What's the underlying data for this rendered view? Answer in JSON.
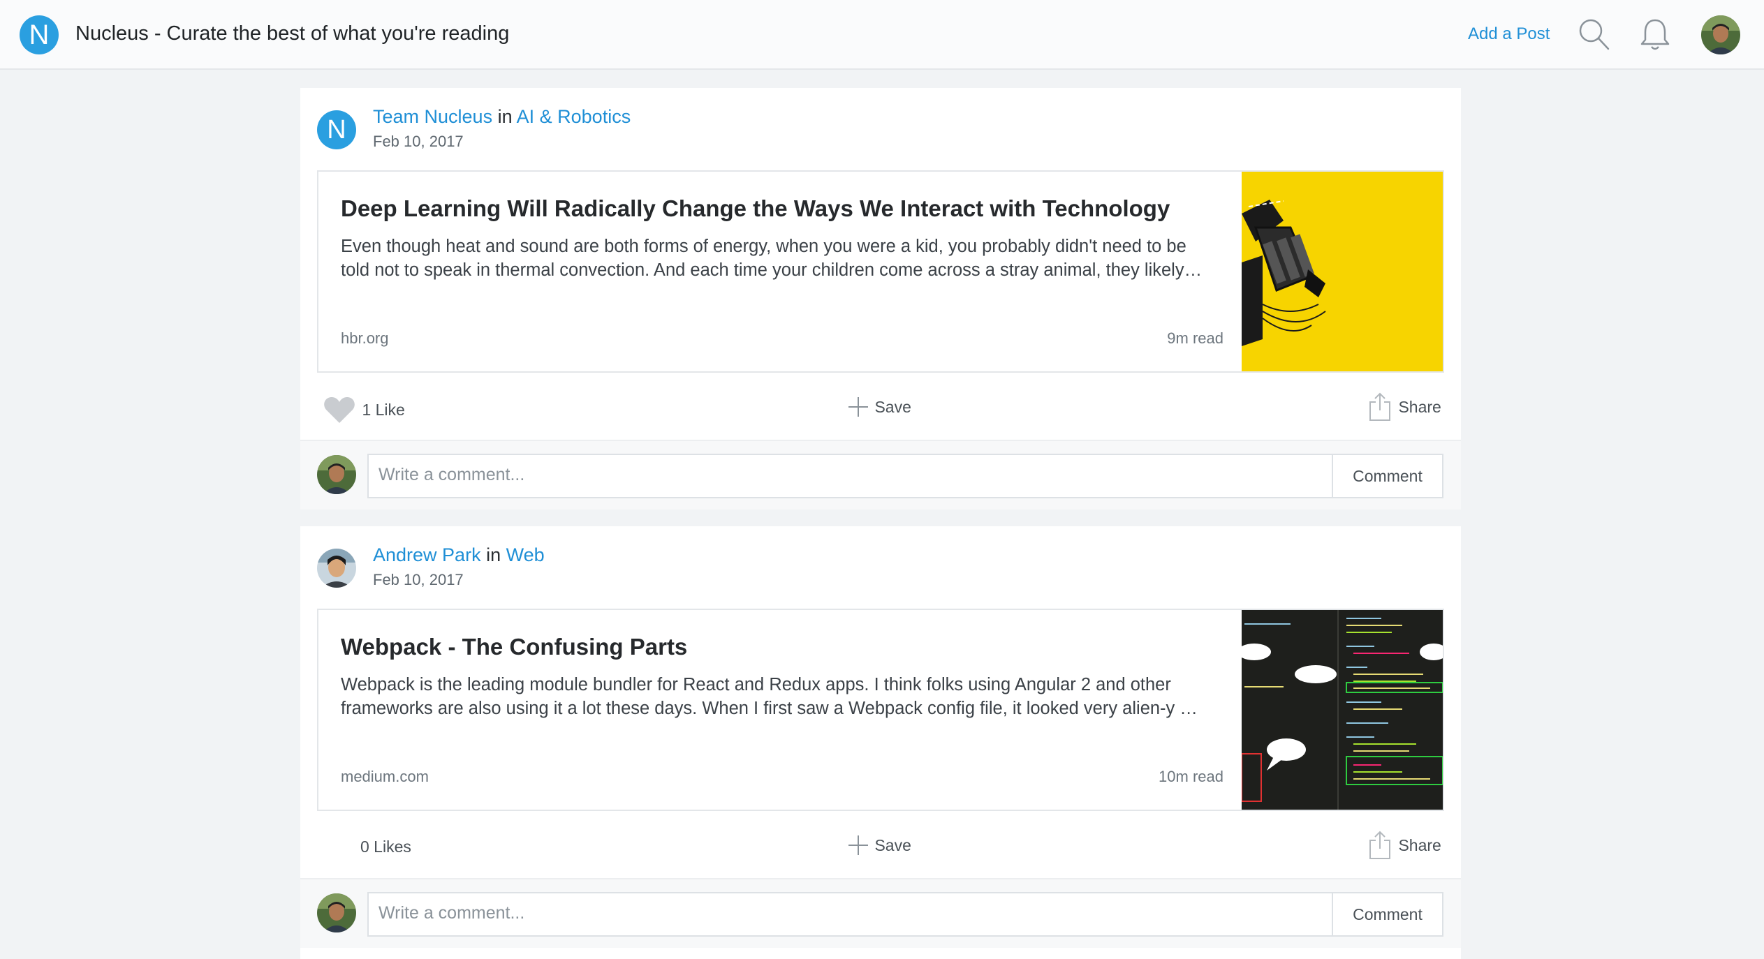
{
  "app": {
    "logo_letter": "N",
    "title": "Nucleus - Curate the best of what you're reading",
    "add_post_label": "Add a Post",
    "accent_color": "#2a9fe0",
    "link_color": "#1f8fd6"
  },
  "icons": {
    "search": "search-icon",
    "notifications": "bell-icon",
    "like": "heart-icon",
    "save": "plus-icon",
    "share": "share-icon"
  },
  "posts": [
    {
      "author_initial": "N",
      "author": "Team Nucleus",
      "in_word": "in",
      "category": "AI & Robotics",
      "date": "Feb 10, 2017",
      "article": {
        "title": "Deep Learning Will Radically Change the Ways We Interact with Technology",
        "excerpt": "Even though heat and sound are both forms of energy, when you were a kid, you probably didn't need to be\ntold not to speak in thermal convection. And each time your children come across a stray animal, they likely…",
        "source": "hbr.org",
        "read_time": "9m read"
      },
      "likes_label": "1 Like",
      "save_label": "Save",
      "share_label": "Share",
      "comment_placeholder": "Write a comment...",
      "comment_button": "Comment"
    },
    {
      "author": "Andrew Park",
      "in_word": "in",
      "category": "Web",
      "date": "Feb 10, 2017",
      "article": {
        "title": "Webpack - The Confusing Parts",
        "excerpt": "Webpack is the leading module bundler for React and Redux apps. I think folks using Angular 2 and other\nframeworks are also using it a lot these days. When I first saw a Webpack config file, it looked very alien-y …",
        "source": "medium.com",
        "read_time": "10m read"
      },
      "likes_label": "0 Likes",
      "save_label": "Save",
      "share_label": "Share",
      "comment_placeholder": "Write a comment...",
      "comment_button": "Comment"
    }
  ]
}
